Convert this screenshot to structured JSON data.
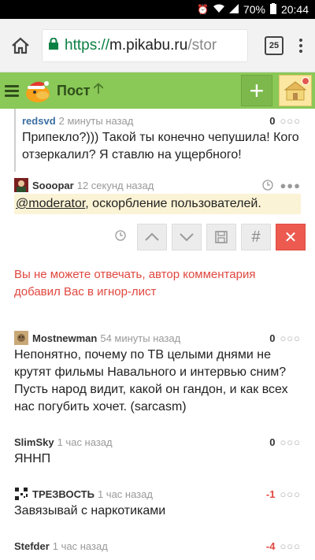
{
  "status_bar": {
    "battery": "70%",
    "time": "20:44"
  },
  "browser": {
    "url_scheme": "https://",
    "url_host": "m.pikabu.ru",
    "url_path": "/stor",
    "tab_count": "25"
  },
  "header": {
    "title": "Пост"
  },
  "comments": [
    {
      "author": "redsvd",
      "time": "2 минуты назад",
      "rating": "0",
      "text": "Припекло?))) Такой ты конечно чепушила! Кого отзеркалил? Я ставлю на ущербного!"
    },
    {
      "author": "Sooopar",
      "time": "12 секунд назад",
      "mention": "@moderator",
      "text": ", оскорбление пользователей."
    }
  ],
  "reply_tools": {
    "hash_label": "#"
  },
  "warning_text": "Вы не можете отвечать, автор комментария добавил Вас в игнор-лист",
  "more_comments": [
    {
      "author": "Mostnewman",
      "time": "54 минуты назад",
      "rating": "0",
      "text": "Непонятно, почему по ТВ целыми днями не крутят фильмы Навального и интервью сним? Пусть народ видит, какой он гандон, и как всех нас погубить хочет. (sarcasm)"
    },
    {
      "author": "SlimSky",
      "time": "1 час назад",
      "rating": "0",
      "text": "ЯННП"
    },
    {
      "author": "ТРЕЗВОСТЬ",
      "time": "1 час назад",
      "rating": "-1",
      "text": "Завязывай с наркотиками"
    },
    {
      "author": "Stefder",
      "time": "1 час назад",
      "rating": "-4",
      "text": ""
    }
  ],
  "colors": {
    "brand_green": "#8ac858",
    "negative": "#e0473f",
    "link_blue": "#3b6fa3"
  }
}
